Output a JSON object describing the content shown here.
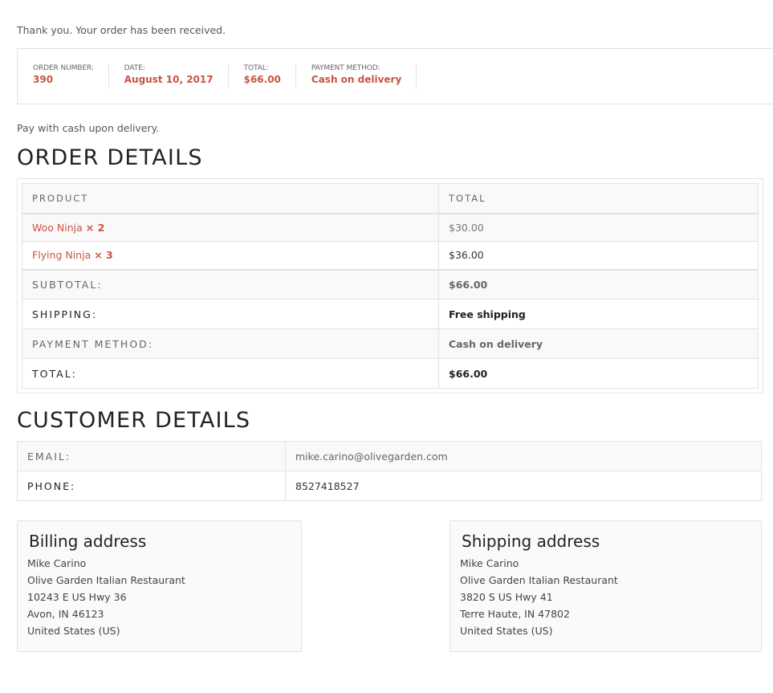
{
  "thankyou_message": "Thank you. Your order has been received.",
  "overview": {
    "order_number_label": "ORDER NUMBER:",
    "order_number": "390",
    "date_label": "DATE:",
    "date": "August 10, 2017",
    "total_label": "TOTAL:",
    "total": "$66.00",
    "payment_method_label": "PAYMENT METHOD:",
    "payment_method": "Cash on delivery"
  },
  "payment_note": "Pay with cash upon delivery.",
  "order_details": {
    "title": "ORDER DETAILS",
    "headers": {
      "product": "PRODUCT",
      "total": "TOTAL"
    },
    "items": [
      {
        "product": "Woo Ninja",
        "qty": "× 2",
        "total": "$30.00"
      },
      {
        "product": "Flying Ninja",
        "qty": "× 3",
        "total": "$36.00"
      }
    ],
    "totals": [
      {
        "label": "SUBTOTAL:",
        "value": "$66.00"
      },
      {
        "label": "SHIPPING:",
        "value": "Free shipping"
      },
      {
        "label": "PAYMENT METHOD:",
        "value": "Cash on delivery"
      },
      {
        "label": "TOTAL:",
        "value": "$66.00"
      }
    ]
  },
  "customer_details": {
    "title": "CUSTOMER DETAILS",
    "email_label": "EMAIL:",
    "email": "mike.carino@olivegarden.com",
    "phone_label": "PHONE:",
    "phone": "8527418527"
  },
  "billing_address": {
    "title": "Billing address",
    "lines": [
      "Mike Carino",
      "Olive Garden Italian Restaurant",
      "10243 E US Hwy 36",
      "Avon, IN 46123",
      "United States (US)"
    ]
  },
  "shipping_address": {
    "title": "Shipping address",
    "lines": [
      "Mike Carino",
      "Olive Garden Italian Restaurant",
      "3820 S US Hwy 41",
      "Terre Haute, IN 47802",
      "United States (US)"
    ]
  },
  "colors": {
    "accent": "#c8543f",
    "heading": "#222222",
    "text": "#555555",
    "border": "#e2e2e2"
  }
}
